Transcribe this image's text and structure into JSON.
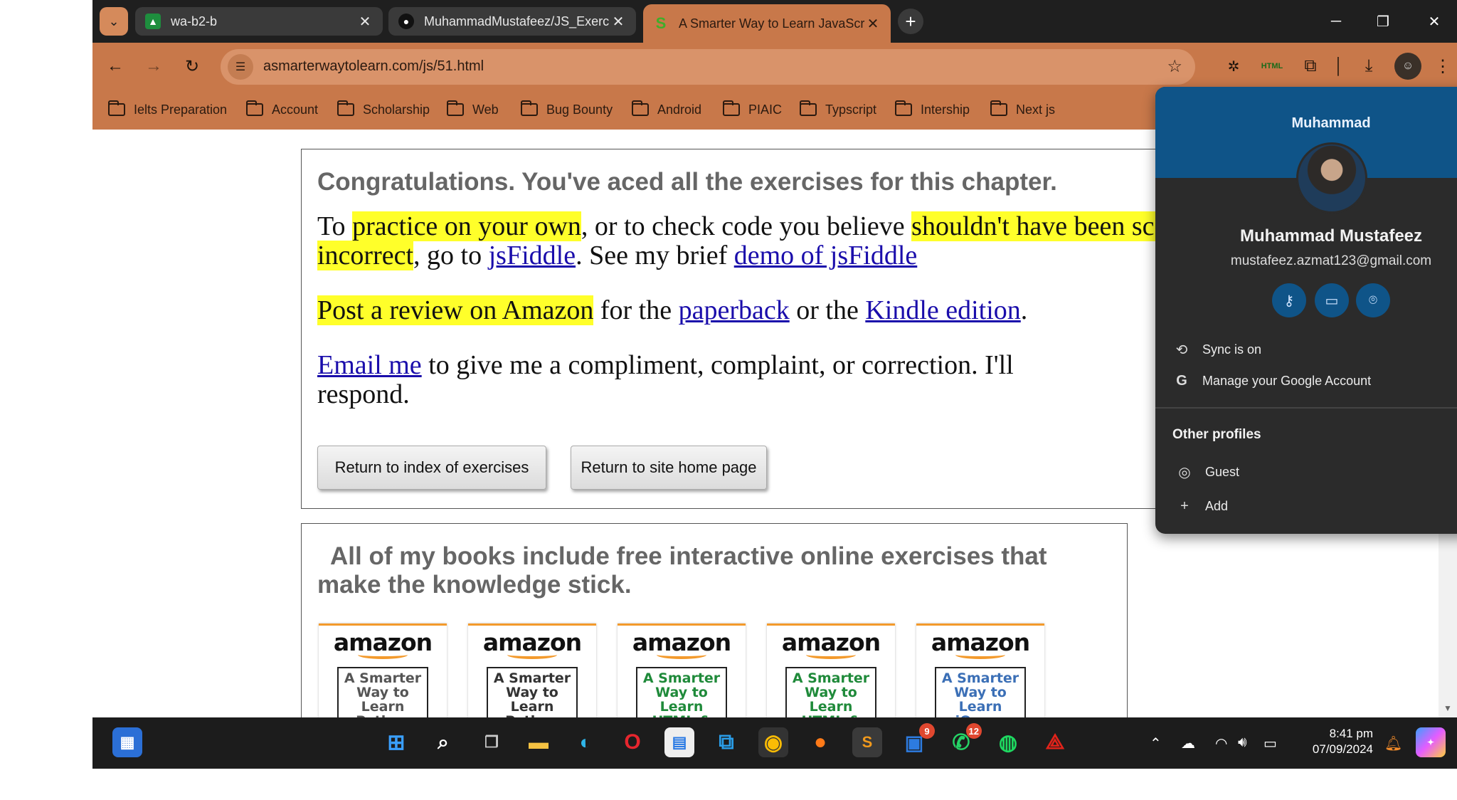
{
  "tabs": [
    {
      "title": "wa-b2-b",
      "favicon": "classroom-icon"
    },
    {
      "title": "MuhammadMustafeez/JS_Exerc",
      "favicon": "github-icon"
    },
    {
      "title": "A Smarter Way to Learn JavaScr",
      "favicon": "site-s-icon",
      "active": true
    }
  ],
  "toolbar": {
    "url": "asmarterwaytolearn.com/js/51.html"
  },
  "bookmarks": [
    "Ielts Preparation",
    "Account",
    "Scholarship",
    "Web",
    "Bug Bounty",
    "Android",
    "PIAIC",
    "Typscript",
    "Intership",
    "Next js"
  ],
  "page": {
    "congrats": "Congratulations. You've aced all the exercises for this chapter.",
    "p1_a": "To ",
    "p1_hl1": "practice on your own",
    "p1_b": ", or to check code you believe ",
    "p1_hl2": "shouldn't have been scored as incorrect",
    "p1_c": ", go to ",
    "p1_link1": "jsFiddle",
    "p1_d": ". See my brief ",
    "p1_link2": "demo of jsFiddle",
    "p2_hl": "Post a review on Amazon",
    "p2_a": " for the ",
    "p2_link1": "paperback",
    "p2_b": " or the ",
    "p2_link2": "Kindle edition",
    "p2_c": ".",
    "p3_link": "Email me",
    "p3_a": " to give me a compliment, complaint, or correction. I'll respond.",
    "btn_index": "Return to index of exercises",
    "btn_home": "Return to site home page",
    "books_heading": "All of my books include free interactive online exercises that make the knowledge stick.",
    "books": [
      {
        "brand": "amazon",
        "cover": "A Smarter Way to Learn Python",
        "color": "#555555"
      },
      {
        "brand": "amazon",
        "cover": "A Smarter Way to Learn Python",
        "color": "#333333"
      },
      {
        "brand": "amazon",
        "cover": "A Smarter Way to Learn HTML & CSS",
        "color": "#1f8a3a"
      },
      {
        "brand": "amazon",
        "cover": "A Smarter Way to Learn HTML & CSS",
        "color": "#1f8a3a"
      },
      {
        "brand": "amazon",
        "cover": "A Smarter Way to Learn jQuery",
        "color": "#3b6fb6"
      }
    ]
  },
  "profile": {
    "header_name": "Muhammad",
    "full_name": "Muhammad Mustafeez",
    "email": "mustafeez.azmat123@gmail.com",
    "sync": "Sync is on",
    "manage": "Manage your Google Account",
    "other_profiles": "Other profiles",
    "guest": "Guest",
    "add": "Add"
  },
  "taskbar": {
    "teams_badge": "9",
    "whatsapp_badge": "12",
    "time": "8:41 pm",
    "date": "07/09/2024"
  }
}
